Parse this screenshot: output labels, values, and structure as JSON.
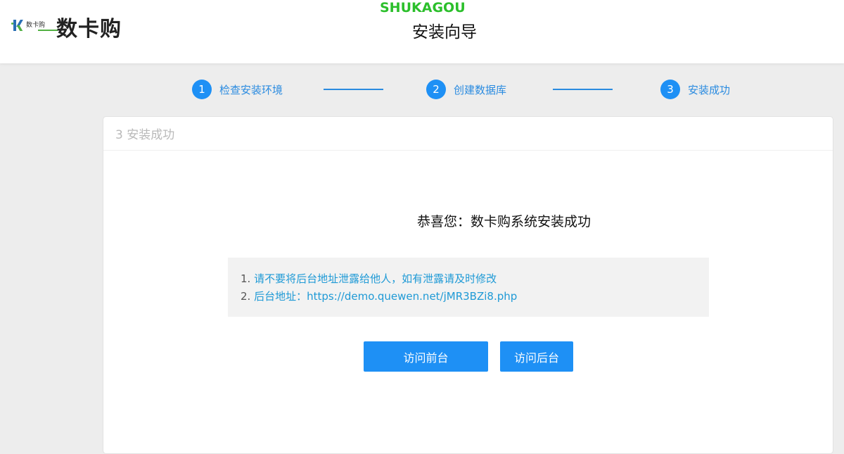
{
  "header": {
    "logo_text": "数卡购",
    "brand_name": "数卡购",
    "watermark": "SHUKAGOU",
    "title": "安装向导"
  },
  "steps": [
    {
      "num": "1",
      "label": "检查安装环境"
    },
    {
      "num": "2",
      "label": "创建数据库"
    },
    {
      "num": "3",
      "label": "安装成功"
    }
  ],
  "card": {
    "header": "3 安装成功",
    "success_title": "恭喜您：数卡购系统安装成功",
    "info": [
      {
        "num": "1.",
        "text": "请不要将后台地址泄露给他人，如有泄露请及时修改"
      },
      {
        "num": "2.",
        "text": "后台地址：https://demo.quewen.net/jMR3BZi8.php"
      }
    ],
    "buttons": {
      "frontend": "访问前台",
      "backend": "访问后台"
    }
  },
  "colors": {
    "accent": "#1e90f5",
    "link": "#1f9ad6",
    "watermark": "#2bbf2b"
  }
}
